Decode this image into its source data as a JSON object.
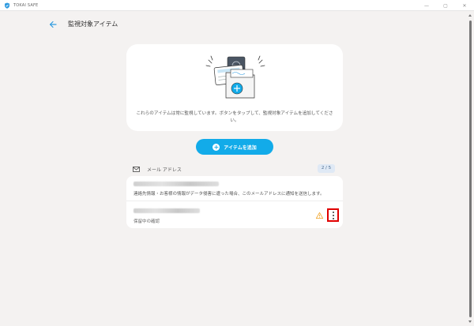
{
  "window": {
    "title": "TOKAI SAFE",
    "minimize_glyph": "—",
    "maximize_glyph": "▢",
    "close_glyph": "✕"
  },
  "header": {
    "title": "監視対象アイテム"
  },
  "info_card": {
    "illustration": "monitor-documents-illustration",
    "description": "これらのアイテムは常に監視しています。ボタンをタップして、監視対象アイテムを追加してください。"
  },
  "add_button": {
    "plus": "+",
    "label": "アイテムを追加"
  },
  "email_section": {
    "icon": "mail-icon",
    "title": "メール アドレス",
    "count": "2 / 5",
    "items": [
      {
        "email": "",
        "description": "連絡先情報・お客様の情報がデータ侵害に遭った場合、このメールアドレスに通知を送信します。"
      },
      {
        "email": "",
        "status": "保留中の確認",
        "has_warning": true
      }
    ]
  },
  "colors": {
    "accent": "#12abe9",
    "background": "#f4f2f1",
    "highlight": "#e00000",
    "warning": "#f0a020"
  }
}
